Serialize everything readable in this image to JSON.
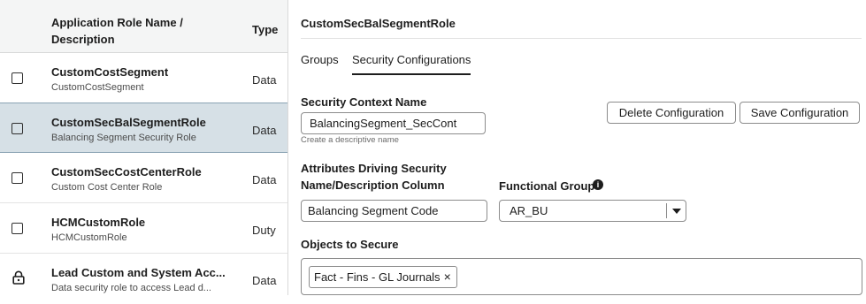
{
  "table": {
    "header": {
      "name_label": "Application Role Name / Description",
      "type_label": "Type"
    },
    "rows": [
      {
        "name": "CustomCostSegment",
        "description": "CustomCostSegment",
        "type": "Data",
        "selected": false,
        "locked": false
      },
      {
        "name": "CustomSecBalSegmentRole",
        "description": "Balancing Segment Security Role",
        "type": "Data",
        "selected": true,
        "locked": false
      },
      {
        "name": "CustomSecCostCenterRole",
        "description": "Custom Cost Center Role",
        "type": "Data",
        "selected": false,
        "locked": false
      },
      {
        "name": "HCMCustomRole",
        "description": "HCMCustomRole",
        "type": "Duty",
        "selected": false,
        "locked": false
      },
      {
        "name": "Lead Custom and System Acc...",
        "description": "Data security role to access Lead d...",
        "type": "Data",
        "selected": false,
        "locked": true
      }
    ]
  },
  "detail": {
    "title": "CustomSecBalSegmentRole",
    "tabs": [
      {
        "label": "Groups",
        "active": false
      },
      {
        "label": "Security Configurations",
        "active": true
      }
    ],
    "security_context": {
      "label": "Security Context Name",
      "value": "BalancingSegment_SecCont",
      "hint": "Create a descriptive name"
    },
    "buttons": {
      "delete": "Delete Configuration",
      "save": "Save Configuration"
    },
    "attributes": {
      "section_label": "Attributes Driving Security",
      "name_desc_label": "Name/Description Column",
      "name_desc_value": "Balancing Segment Code",
      "functional_group_label": "Functional Group",
      "functional_group_value": "AR_BU"
    },
    "objects": {
      "label": "Objects to Secure",
      "chips": [
        "Fact - Fins - GL Journals"
      ]
    }
  },
  "icons": {
    "checkbox": "checkbox-icon",
    "lock": "lock-icon",
    "info": "info-icon",
    "dropdown": "chevron-down-icon",
    "remove": "close-icon"
  }
}
